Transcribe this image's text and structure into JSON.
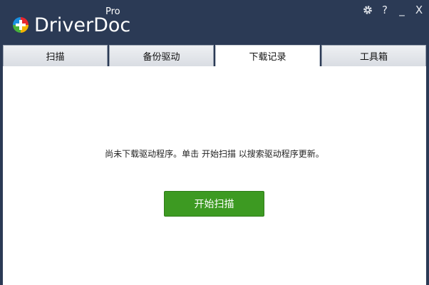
{
  "app": {
    "brand_name": "DriverDoc",
    "brand_edition": "Pro"
  },
  "window_controls": {
    "help": "?",
    "minimize": "_",
    "close": "X"
  },
  "tabs": [
    {
      "label": "扫描",
      "active": false
    },
    {
      "label": "备份驱动",
      "active": false
    },
    {
      "label": "下载记录",
      "active": true
    },
    {
      "label": "工具箱",
      "active": false
    }
  ],
  "main": {
    "message": "尚未下载驱动程序。单击 开始扫描 以搜索驱动程序更新。",
    "start_button_label": "开始扫描"
  },
  "colors": {
    "header_bg": "#2b3a55",
    "accent_green": "#3d9a22",
    "logo_red": "#e8262d",
    "logo_blue": "#1a8fe0",
    "logo_green": "#48b23a",
    "logo_yellow": "#f4b400"
  },
  "icons": [
    "gear-icon",
    "help-icon",
    "minimize-icon",
    "close-icon",
    "driverdoc-logo-icon"
  ]
}
